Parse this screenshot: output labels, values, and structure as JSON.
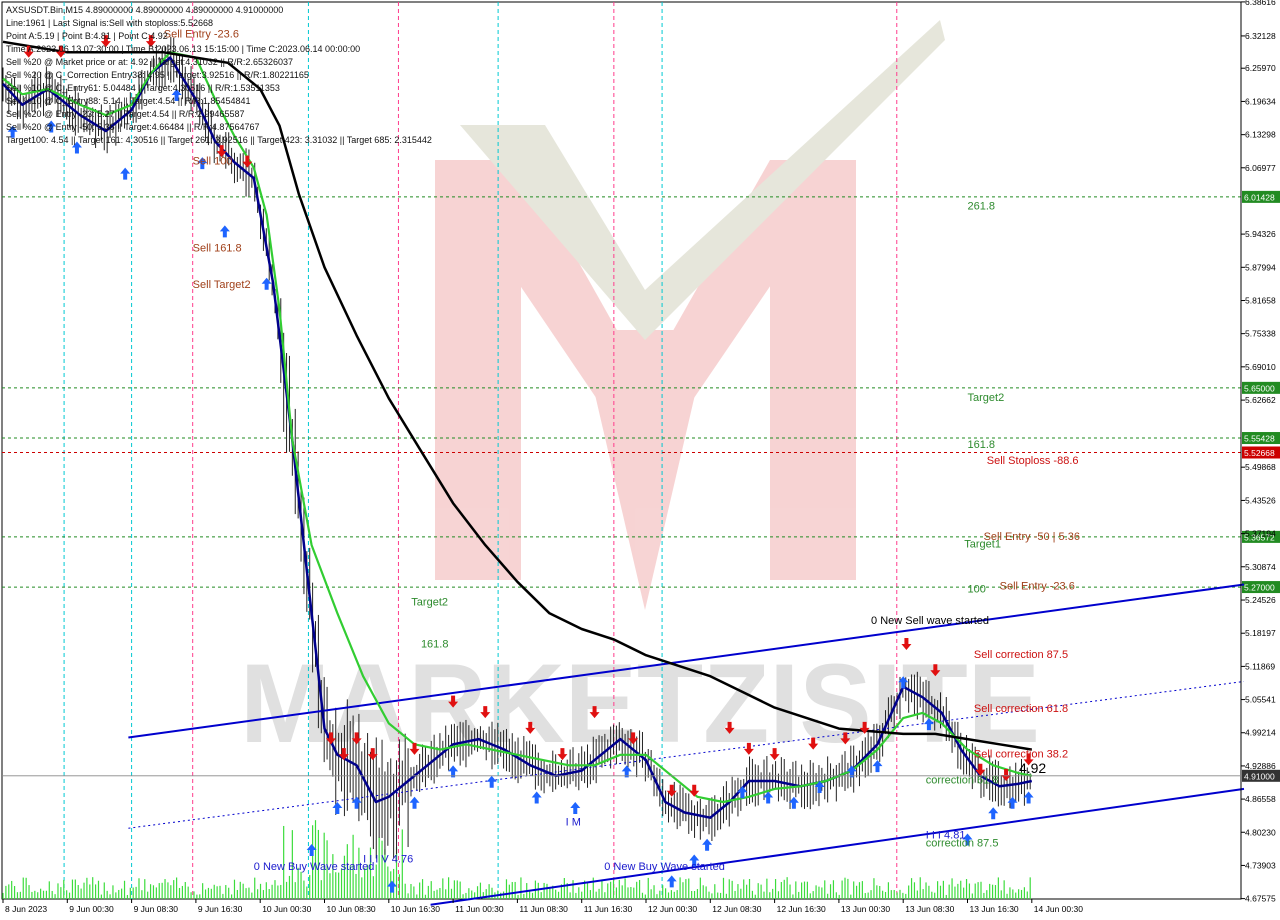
{
  "header": {
    "lines": [
      "AXSUSDT.Bin,M15  4.89000000 4.89000000 4.89000000 4.91000000",
      "Line:1961 | Last Signal is:Sell with stoploss:5.52668",
      "Point A:5.19 | Point B:4.81 | Point C:4.92",
      "Time A:2023.06.13 07:30:00 | Time B:2023.06.13 15:15:00 | Time C:2023.06.14 00:00:00",
      "Sell %20 @ Market price or at: 4.92 || Target:4.31032 || R/R:2.65326037",
      "Sell %20 @ C_Correction Entry38: 4.95 || Target:3.92516 || R/R:1.80221165",
      "Sell %10 @ C_Entry61: 5.04484 || Target:4.30516 || R/R:1.53511353",
      "Sell %10 @ C_Entry88: 5.14 || Target:4.54 || R/R:1.85454841",
      "Sell %20 @ Entry -23: 5.27 || Target:4.54 || R/R:2.99465587",
      "Sell %20 @ Entry -50: 5.36 || Target:4.66484 || R/R:4.87564767",
      "Target100: 4.54 || Target 161: 4.30516 || Target 261: 3.92516 || Target 423: 3.31032 || Target 685: 2.315442"
    ]
  },
  "watermark": {
    "text": "MARKETZISITE",
    "colors": {
      "primary": "#e88a8a",
      "secondary": "#d7d3a8"
    }
  },
  "colors": {
    "ema_fast": "#00008b",
    "ema_mid": "#32cd32",
    "ema_slow": "#000000",
    "channel": "#0000cd",
    "buy_arrow": "#1e64ff",
    "sell_arrow": "#e01010",
    "level_green": "#228b22",
    "level_red": "#cc0000",
    "vline_pink": "#ff3c8c",
    "vline_cyan": "#00c8d2",
    "price_bg": "#333333"
  },
  "chart_data": {
    "type": "line",
    "symbol": "AXSUSDT.Bin",
    "timeframe": "M15",
    "y_axis": {
      "range": [
        4.675,
        6.386
      ],
      "ticks": [
        "6.38616",
        "6.32128",
        "6.25970",
        "6.19634",
        "6.13298",
        "6.06977",
        "5.94326",
        "5.87994",
        "5.81658",
        "5.75338",
        "5.69010",
        "5.62662",
        "5.49868",
        "5.43526",
        "5.37194",
        "5.30874",
        "5.24526",
        "5.18197",
        "5.11869",
        "5.05541",
        "4.99214",
        "4.92886",
        "4.86558",
        "4.80230",
        "4.73903",
        "4.67575"
      ],
      "tick_values": [
        6.38616,
        6.32128,
        6.2597,
        6.19634,
        6.13298,
        6.06977,
        5.94326,
        5.87994,
        5.81658,
        5.75338,
        5.6901,
        5.62662,
        5.49868,
        5.43526,
        5.37194,
        5.30874,
        5.24526,
        5.18197,
        5.11869,
        5.05541,
        4.99214,
        4.92886,
        4.86558,
        4.8023,
        4.73903,
        4.67575
      ]
    },
    "x_axis": {
      "labels": [
        "8 Jun 2023",
        "9 Jun 00:30",
        "9 Jun 08:30",
        "9 Jun 16:30",
        "10 Jun 00:30",
        "10 Jun 08:30",
        "10 Jun 16:30",
        "11 Jun 00:30",
        "11 Jun 08:30",
        "11 Jun 16:30",
        "12 Jun 00:30",
        "12 Jun 08:30",
        "12 Jun 16:30",
        "13 Jun 00:30",
        "13 Jun 08:30",
        "13 Jun 16:30",
        "14 Jun 00:30"
      ],
      "label_index": [
        0,
        1,
        2,
        3,
        4,
        5,
        6,
        7,
        8,
        9,
        10,
        11,
        12,
        13,
        14,
        15,
        16
      ]
    },
    "current_price": {
      "value": 4.91,
      "label": "4.91000"
    },
    "horizontal_levels": [
      {
        "value": 6.01428,
        "tag": "6.01428",
        "color": "green"
      },
      {
        "value": 5.65,
        "tag": "5.65000",
        "color": "green"
      },
      {
        "value": 5.55428,
        "tag": "5.55428",
        "color": "green"
      },
      {
        "value": 5.52668,
        "tag": "5.52668",
        "color": "red"
      },
      {
        "value": 5.36572,
        "tag": "5.36572",
        "color": "green"
      },
      {
        "value": 5.27,
        "tag": "5.27000",
        "color": "green"
      }
    ],
    "level_labels": [
      {
        "text": "261.8",
        "t": 15.0,
        "price": 5.99,
        "color": "green"
      },
      {
        "text": "Target2",
        "t": 15.0,
        "price": 5.625,
        "color": "green"
      },
      {
        "text": "161.8",
        "t": 15.0,
        "price": 5.535,
        "color": "green"
      },
      {
        "text": "Sell Stoploss -88.6",
        "t": 15.3,
        "price": 5.505,
        "color": "red"
      },
      {
        "text": "Sell Entry -50 | 5.36",
        "t": 15.25,
        "price": 5.36,
        "color": "brown"
      },
      {
        "text": "Target1",
        "t": 14.95,
        "price": 5.345,
        "color": "green"
      },
      {
        "text": "Sell Entry -23.6",
        "t": 15.5,
        "price": 5.265,
        "color": "brown"
      },
      {
        "text": "100",
        "t": 15.0,
        "price": 5.26,
        "color": "green"
      },
      {
        "text": "Target2",
        "t": 6.35,
        "price": 5.235,
        "color": "green"
      },
      {
        "text": "161.8",
        "t": 6.5,
        "price": 5.155,
        "color": "green"
      },
      {
        "text": "Sell 100",
        "t": 2.95,
        "price": 6.076,
        "color": "brown"
      },
      {
        "text": "Sell 161.8",
        "t": 2.95,
        "price": 5.91,
        "color": "brown"
      },
      {
        "text": "Sell Target2",
        "t": 2.95,
        "price": 5.84,
        "color": "brown"
      },
      {
        "text": "Sell Entry -23.6",
        "t": 2.5,
        "price": 6.318,
        "color": "brown"
      }
    ],
    "annotations": [
      {
        "text": "0 New Sell wave started",
        "t": 13.5,
        "price": 5.2,
        "color": "black"
      },
      {
        "text": "Sell correction 87.5",
        "t": 15.1,
        "price": 5.135,
        "color": "red"
      },
      {
        "text": "Sell correction 61.8",
        "t": 15.1,
        "price": 5.032,
        "color": "red"
      },
      {
        "text": "Sell correction 38.2",
        "t": 15.1,
        "price": 4.945,
        "color": "red"
      },
      {
        "text": "4.92",
        "t": 15.8,
        "price": 4.915,
        "color": "black"
      },
      {
        "text": "correction 61.8",
        "t": 14.35,
        "price": 4.895,
        "color": "green"
      },
      {
        "text": "correction 87.5",
        "t": 14.35,
        "price": 4.775,
        "color": "green"
      },
      {
        "text": "I I I 4.81",
        "t": 14.35,
        "price": 4.79,
        "color": "blue"
      },
      {
        "text": "0 New Buy Wave started",
        "t": 3.9,
        "price": 4.73,
        "color": "blue"
      },
      {
        "text": "I I I V 4.76",
        "t": 5.6,
        "price": 4.745,
        "color": "blue"
      },
      {
        "text": "0 New Buy Wave started",
        "t": 9.35,
        "price": 4.73,
        "color": "blue"
      },
      {
        "text": "I M",
        "t": 8.75,
        "price": 4.815,
        "color": "blue"
      }
    ],
    "vertical_lines": [
      {
        "t": 0.95,
        "color": "cyan"
      },
      {
        "t": 2.0,
        "color": "cyan"
      },
      {
        "t": 2.95,
        "color": "pink"
      },
      {
        "t": 4.75,
        "color": "cyan"
      },
      {
        "t": 6.15,
        "color": "pink"
      },
      {
        "t": 7.7,
        "color": "cyan"
      },
      {
        "t": 9.5,
        "color": "pink"
      },
      {
        "t": 10.25,
        "color": "cyan"
      },
      {
        "t": 13.9,
        "color": "pink"
      }
    ],
    "channel_lines": [
      {
        "t1": 1.95,
        "p1": 4.983,
        "t2": 19.3,
        "p2": 5.275,
        "style": "solid"
      },
      {
        "t1": 6.65,
        "p1": 4.664,
        "t2": 19.3,
        "p2": 4.885,
        "style": "solid"
      },
      {
        "t1": 1.95,
        "p1": 4.81,
        "t2": 19.3,
        "p2": 5.09,
        "style": "dotted"
      }
    ],
    "series": [
      {
        "name": "",
        "kind": "ema_fast",
        "points": [
          [
            0,
            6.23
          ],
          [
            0.3,
            6.19
          ],
          [
            0.7,
            6.22
          ],
          [
            1.2,
            6.17
          ],
          [
            1.6,
            6.14
          ],
          [
            2.0,
            6.18
          ],
          [
            2.3,
            6.25
          ],
          [
            2.6,
            6.28
          ],
          [
            3.0,
            6.2
          ],
          [
            3.3,
            6.12
          ],
          [
            3.6,
            6.08
          ],
          [
            3.9,
            6.05
          ],
          [
            4.2,
            5.85
          ],
          [
            4.5,
            5.55
          ],
          [
            4.8,
            5.22
          ],
          [
            5.0,
            5.0
          ],
          [
            5.2,
            4.95
          ],
          [
            5.5,
            4.93
          ],
          [
            5.8,
            4.86
          ],
          [
            6.0,
            4.87
          ],
          [
            6.3,
            4.9
          ],
          [
            6.6,
            4.93
          ],
          [
            7.0,
            4.97
          ],
          [
            7.4,
            4.98
          ],
          [
            7.8,
            4.96
          ],
          [
            8.2,
            4.93
          ],
          [
            8.6,
            4.91
          ],
          [
            9.0,
            4.92
          ],
          [
            9.3,
            4.95
          ],
          [
            9.6,
            4.98
          ],
          [
            10.0,
            4.94
          ],
          [
            10.3,
            4.86
          ],
          [
            10.6,
            4.84
          ],
          [
            11.0,
            4.83
          ],
          [
            11.3,
            4.86
          ],
          [
            11.6,
            4.9
          ],
          [
            12.0,
            4.9
          ],
          [
            12.4,
            4.89
          ],
          [
            12.8,
            4.9
          ],
          [
            13.2,
            4.92
          ],
          [
            13.6,
            4.97
          ],
          [
            14.0,
            5.08
          ],
          [
            14.3,
            5.06
          ],
          [
            14.6,
            5.03
          ],
          [
            14.9,
            4.96
          ],
          [
            15.2,
            4.91
          ],
          [
            15.5,
            4.89
          ],
          [
            15.8,
            4.895
          ],
          [
            16.0,
            4.9
          ]
        ]
      },
      {
        "name": "",
        "kind": "ema_mid",
        "points": [
          [
            0,
            6.24
          ],
          [
            0.3,
            6.21
          ],
          [
            0.7,
            6.22
          ],
          [
            1.2,
            6.19
          ],
          [
            1.6,
            6.17
          ],
          [
            2.0,
            6.19
          ],
          [
            2.3,
            6.25
          ],
          [
            2.6,
            6.29
          ],
          [
            3.0,
            6.28
          ],
          [
            3.3,
            6.2
          ],
          [
            3.6,
            6.13
          ],
          [
            3.9,
            6.07
          ],
          [
            4.1,
            5.98
          ],
          [
            4.3,
            5.8
          ],
          [
            4.5,
            5.55
          ],
          [
            4.8,
            5.35
          ],
          [
            5.2,
            5.22
          ],
          [
            5.6,
            5.1
          ],
          [
            6.0,
            5.01
          ],
          [
            6.4,
            4.97
          ],
          [
            6.8,
            4.96
          ],
          [
            7.2,
            4.97
          ],
          [
            7.6,
            4.96
          ],
          [
            8.0,
            4.95
          ],
          [
            8.4,
            4.94
          ],
          [
            8.8,
            4.93
          ],
          [
            9.2,
            4.93
          ],
          [
            9.6,
            4.95
          ],
          [
            10.0,
            4.95
          ],
          [
            10.4,
            4.91
          ],
          [
            10.8,
            4.87
          ],
          [
            11.2,
            4.86
          ],
          [
            11.6,
            4.87
          ],
          [
            12.0,
            4.885
          ],
          [
            12.4,
            4.89
          ],
          [
            12.8,
            4.9
          ],
          [
            13.2,
            4.92
          ],
          [
            13.6,
            4.96
          ],
          [
            14.0,
            5.02
          ],
          [
            14.3,
            5.03
          ],
          [
            14.6,
            5.01
          ],
          [
            15.0,
            4.96
          ],
          [
            15.4,
            4.93
          ],
          [
            15.8,
            4.915
          ],
          [
            16.0,
            4.91
          ]
        ]
      },
      {
        "name": "",
        "kind": "ema_slow",
        "points": [
          [
            0,
            6.31
          ],
          [
            0.5,
            6.3
          ],
          [
            1.0,
            6.29
          ],
          [
            1.5,
            6.29
          ],
          [
            2.0,
            6.29
          ],
          [
            2.5,
            6.29
          ],
          [
            3.0,
            6.28
          ],
          [
            3.5,
            6.27
          ],
          [
            4.0,
            6.22
          ],
          [
            4.3,
            6.15
          ],
          [
            4.6,
            6.02
          ],
          [
            5.0,
            5.88
          ],
          [
            5.5,
            5.75
          ],
          [
            6.0,
            5.63
          ],
          [
            6.5,
            5.53
          ],
          [
            7.0,
            5.43
          ],
          [
            7.5,
            5.35
          ],
          [
            8.0,
            5.28
          ],
          [
            8.5,
            5.22
          ],
          [
            9.0,
            5.19
          ],
          [
            9.5,
            5.17
          ],
          [
            10.0,
            5.14
          ],
          [
            10.5,
            5.12
          ],
          [
            11.0,
            5.1
          ],
          [
            11.5,
            5.07
          ],
          [
            12.0,
            5.04
          ],
          [
            12.5,
            5.02
          ],
          [
            13.0,
            5.0
          ],
          [
            13.5,
            4.995
          ],
          [
            14.0,
            4.99
          ],
          [
            14.5,
            4.99
          ],
          [
            15.0,
            4.98
          ],
          [
            15.5,
            4.97
          ],
          [
            16.0,
            4.96
          ]
        ]
      }
    ],
    "buy_markers": [
      [
        0.15,
        6.15
      ],
      [
        0.75,
        6.16
      ],
      [
        1.15,
        6.12
      ],
      [
        1.9,
        6.07
      ],
      [
        2.7,
        6.22
      ],
      [
        3.1,
        6.09
      ],
      [
        3.45,
        5.96
      ],
      [
        4.1,
        5.86
      ],
      [
        4.8,
        4.78
      ],
      [
        5.2,
        4.86
      ],
      [
        5.5,
        4.87
      ],
      [
        6.05,
        4.71
      ],
      [
        6.4,
        4.87
      ],
      [
        7.0,
        4.93
      ],
      [
        7.6,
        4.91
      ],
      [
        8.3,
        4.88
      ],
      [
        8.9,
        4.86
      ],
      [
        9.7,
        4.93
      ],
      [
        10.4,
        4.72
      ],
      [
        10.75,
        4.76
      ],
      [
        10.95,
        4.79
      ],
      [
        11.5,
        4.89
      ],
      [
        11.9,
        4.88
      ],
      [
        12.3,
        4.87
      ],
      [
        12.7,
        4.9
      ],
      [
        13.2,
        4.93
      ],
      [
        13.6,
        4.94
      ],
      [
        14.0,
        5.1
      ],
      [
        14.4,
        5.02
      ],
      [
        15.0,
        4.8
      ],
      [
        15.4,
        4.85
      ],
      [
        15.7,
        4.87
      ],
      [
        15.95,
        4.88
      ]
    ],
    "sell_markers": [
      [
        0.4,
        6.28
      ],
      [
        0.9,
        6.28
      ],
      [
        1.6,
        6.3
      ],
      [
        2.3,
        6.3
      ],
      [
        3.4,
        6.09
      ],
      [
        3.8,
        6.07
      ],
      [
        5.1,
        4.97
      ],
      [
        5.3,
        4.94
      ],
      [
        5.5,
        4.97
      ],
      [
        5.75,
        4.94
      ],
      [
        6.4,
        4.95
      ],
      [
        7.0,
        5.04
      ],
      [
        7.5,
        5.02
      ],
      [
        8.2,
        4.99
      ],
      [
        8.7,
        4.94
      ],
      [
        9.2,
        5.02
      ],
      [
        9.8,
        4.97
      ],
      [
        10.4,
        4.87
      ],
      [
        10.75,
        4.87
      ],
      [
        11.3,
        4.99
      ],
      [
        11.6,
        4.95
      ],
      [
        12.0,
        4.94
      ],
      [
        12.6,
        4.96
      ],
      [
        13.1,
        4.97
      ],
      [
        13.4,
        4.99
      ],
      [
        14.05,
        5.15
      ],
      [
        14.5,
        5.1
      ],
      [
        15.2,
        4.91
      ],
      [
        15.6,
        4.9
      ],
      [
        15.95,
        4.93
      ]
    ]
  }
}
